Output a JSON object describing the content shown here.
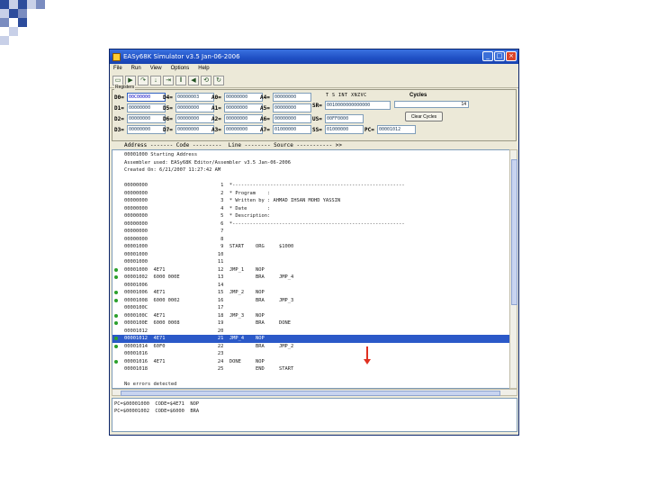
{
  "window": {
    "title": "EASy68K Simulator v3.5 Jan-06-2006",
    "menu": [
      "File",
      "Run",
      "View",
      "Options",
      "Help"
    ]
  },
  "registers_title": "Registers",
  "registers": {
    "D0": "00C00000",
    "D1": "00000000",
    "D2": "00000000",
    "D3": "00000000",
    "D4": "00000003",
    "D5": "00000000",
    "D6": "00000000",
    "D7": "00000000",
    "A0": "00000000",
    "A1": "00000000",
    "A2": "00000000",
    "A3": "00000000",
    "A4": "00000000",
    "A5": "00000000",
    "A6": "00000000",
    "A7": "01000000",
    "SR_label": "SR=",
    "SR": "0010000000000000",
    "US_label": "US=",
    "US": "00FF0000",
    "SS_label": "SS=",
    "SS": "01000000",
    "PC_label": "PC=",
    "PC": "00001012"
  },
  "flag_header": "T S  INT   XNZVC",
  "cycles_label": "Cycles",
  "cycles_value": "14",
  "clear_cycles_label": "Clear Cycles",
  "listing_header": "Address ------- Code ---------  Line -------- Source ----------- >>",
  "listing": [
    {
      "text": "00001000 Starting Address",
      "bp": false,
      "hl": false
    },
    {
      "text": "Assembler used: EASy68K Editor/Assembler v3.5 Jan-06-2006",
      "bp": false,
      "hl": false
    },
    {
      "text": "Created On: 6/21/2007 11:27:42 AM",
      "bp": false,
      "hl": false
    },
    {
      "text": "",
      "bp": false,
      "hl": false
    },
    {
      "text": "00000000                         1  *-----------------------------------------------------------",
      "bp": false,
      "hl": false
    },
    {
      "text": "00000000                         2  * Program    :",
      "bp": false,
      "hl": false
    },
    {
      "text": "00000000                         3  * Written by : AHMAD IHSAN MOHD YASSIN",
      "bp": false,
      "hl": false
    },
    {
      "text": "00000000                         4  * Date       :",
      "bp": false,
      "hl": false
    },
    {
      "text": "00000000                         5  * Description:",
      "bp": false,
      "hl": false
    },
    {
      "text": "00000000                         6  *-----------------------------------------------------------",
      "bp": false,
      "hl": false
    },
    {
      "text": "00000000                         7",
      "bp": false,
      "hl": false
    },
    {
      "text": "00000000                         8",
      "bp": false,
      "hl": false
    },
    {
      "text": "00001000                         9  START    ORG     $1000",
      "bp": false,
      "hl": false
    },
    {
      "text": "00001000                        10",
      "bp": false,
      "hl": false
    },
    {
      "text": "00001000                        11",
      "bp": false,
      "hl": false
    },
    {
      "text": "00001000  4E71                  12  JMP_1    NOP",
      "bp": true,
      "hl": false
    },
    {
      "text": "00001002  6000 000E             13           BRA     JMP_4",
      "bp": true,
      "hl": false
    },
    {
      "text": "00001006                        14",
      "bp": false,
      "hl": false
    },
    {
      "text": "00001006  4E71                  15  JMP_2    NOP",
      "bp": true,
      "hl": false
    },
    {
      "text": "00001008  6000 0002             16           BRA     JMP_3",
      "bp": true,
      "hl": false
    },
    {
      "text": "0000100C                        17",
      "bp": false,
      "hl": false
    },
    {
      "text": "0000100C  4E71                  18  JMP_3    NOP",
      "bp": true,
      "hl": false
    },
    {
      "text": "0000100E  6000 0008             19           BRA     DONE",
      "bp": true,
      "hl": false
    },
    {
      "text": "00001012                        20",
      "bp": false,
      "hl": false
    },
    {
      "text": "00001012  4E71                  21  JMP_4    NOP",
      "bp": true,
      "hl": true
    },
    {
      "text": "00001014  60F0                  22           BRA     JMP_2",
      "bp": true,
      "hl": false
    },
    {
      "text": "00001016                        23",
      "bp": false,
      "hl": false
    },
    {
      "text": "00001016  4E71                  24  DONE     NOP",
      "bp": true,
      "hl": false
    },
    {
      "text": "00001018                        25           END     START",
      "bp": false,
      "hl": false
    },
    {
      "text": "",
      "bp": false,
      "hl": false
    },
    {
      "text": "No errors detected",
      "bp": false,
      "hl": false
    }
  ],
  "output": [
    "PC=$00001000  CODE=$4E71  NOP",
    "PC=$00001002  CODE=$6000  BRA"
  ]
}
